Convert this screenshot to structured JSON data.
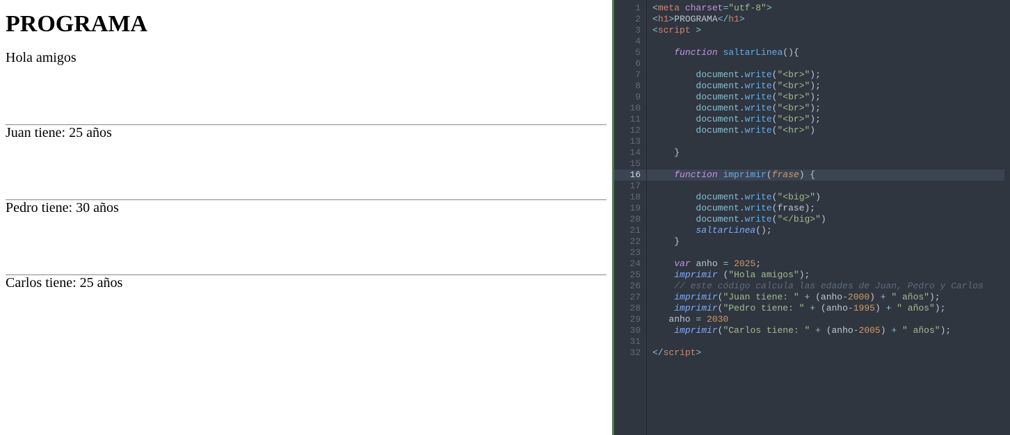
{
  "output": {
    "heading": "PROGRAMA",
    "lines": [
      "Hola amigos",
      "Juan tiene: 25 años",
      "Pedro tiene: 30 años",
      "Carlos tiene: 25 años"
    ]
  },
  "editor": {
    "highlighted_line": 16,
    "line_count": 32,
    "code_lines": {
      "l1": {
        "segments": [
          {
            "t": "<",
            "c": "pun"
          },
          {
            "t": "meta ",
            "c": "tag"
          },
          {
            "t": "charset",
            "c": "attr"
          },
          {
            "t": "=",
            "c": "pun"
          },
          {
            "t": "\"utf-8\"",
            "c": "str"
          },
          {
            "t": ">",
            "c": "pun"
          }
        ]
      },
      "l2": {
        "segments": [
          {
            "t": "<",
            "c": "pun"
          },
          {
            "t": "h1",
            "c": "tag"
          },
          {
            "t": ">",
            "c": "pun"
          },
          {
            "t": "PROGRAMA",
            "c": "plain"
          },
          {
            "t": "</",
            "c": "pun"
          },
          {
            "t": "h1",
            "c": "tag"
          },
          {
            "t": ">",
            "c": "pun"
          }
        ]
      },
      "l3": {
        "segments": [
          {
            "t": "<",
            "c": "pun"
          },
          {
            "t": "script ",
            "c": "tag"
          },
          {
            "t": ">",
            "c": "pun"
          }
        ]
      },
      "l4": {
        "segments": []
      },
      "l5": {
        "segments": [
          {
            "t": "    ",
            "c": "plain"
          },
          {
            "t": "function ",
            "c": "kw"
          },
          {
            "t": "saltarLinea",
            "c": "fn"
          },
          {
            "t": "(){",
            "c": "plain"
          }
        ]
      },
      "l6": {
        "segments": []
      },
      "l7": {
        "segments": [
          {
            "t": "        ",
            "c": "plain"
          },
          {
            "t": "document",
            "c": "obj"
          },
          {
            "t": ".",
            "c": "plain"
          },
          {
            "t": "write",
            "c": "prop"
          },
          {
            "t": "(",
            "c": "plain"
          },
          {
            "t": "\"<br>\"",
            "c": "str"
          },
          {
            "t": ");",
            "c": "plain"
          }
        ]
      },
      "l8": {
        "segments": [
          {
            "t": "        ",
            "c": "plain"
          },
          {
            "t": "document",
            "c": "obj"
          },
          {
            "t": ".",
            "c": "plain"
          },
          {
            "t": "write",
            "c": "prop"
          },
          {
            "t": "(",
            "c": "plain"
          },
          {
            "t": "\"<br>\"",
            "c": "str"
          },
          {
            "t": ");",
            "c": "plain"
          }
        ]
      },
      "l9": {
        "segments": [
          {
            "t": "        ",
            "c": "plain"
          },
          {
            "t": "document",
            "c": "obj"
          },
          {
            "t": ".",
            "c": "plain"
          },
          {
            "t": "write",
            "c": "prop"
          },
          {
            "t": "(",
            "c": "plain"
          },
          {
            "t": "\"<br>\"",
            "c": "str"
          },
          {
            "t": ");",
            "c": "plain"
          }
        ]
      },
      "l10": {
        "segments": [
          {
            "t": "        ",
            "c": "plain"
          },
          {
            "t": "document",
            "c": "obj"
          },
          {
            "t": ".",
            "c": "plain"
          },
          {
            "t": "write",
            "c": "prop"
          },
          {
            "t": "(",
            "c": "plain"
          },
          {
            "t": "\"<br>\"",
            "c": "str"
          },
          {
            "t": ");",
            "c": "plain"
          }
        ]
      },
      "l11": {
        "segments": [
          {
            "t": "        ",
            "c": "plain"
          },
          {
            "t": "document",
            "c": "obj"
          },
          {
            "t": ".",
            "c": "plain"
          },
          {
            "t": "write",
            "c": "prop"
          },
          {
            "t": "(",
            "c": "plain"
          },
          {
            "t": "\"<br>\"",
            "c": "str"
          },
          {
            "t": ");",
            "c": "plain"
          }
        ]
      },
      "l12": {
        "segments": [
          {
            "t": "        ",
            "c": "plain"
          },
          {
            "t": "document",
            "c": "obj"
          },
          {
            "t": ".",
            "c": "plain"
          },
          {
            "t": "write",
            "c": "prop"
          },
          {
            "t": "(",
            "c": "plain"
          },
          {
            "t": "\"<hr>\"",
            "c": "str"
          },
          {
            "t": ")",
            "c": "plain"
          }
        ]
      },
      "l13": {
        "segments": []
      },
      "l14": {
        "segments": [
          {
            "t": "    }",
            "c": "plain"
          }
        ]
      },
      "l15": {
        "segments": []
      },
      "l16": {
        "segments": [
          {
            "t": "    ",
            "c": "plain"
          },
          {
            "t": "function ",
            "c": "kw"
          },
          {
            "t": "imprimir",
            "c": "fn"
          },
          {
            "t": "(",
            "c": "plain"
          },
          {
            "t": "frase",
            "c": "param"
          },
          {
            "t": ") {",
            "c": "plain"
          }
        ]
      },
      "l17": {
        "segments": []
      },
      "l18": {
        "segments": [
          {
            "t": "        ",
            "c": "plain"
          },
          {
            "t": "document",
            "c": "obj"
          },
          {
            "t": ".",
            "c": "plain"
          },
          {
            "t": "write",
            "c": "prop"
          },
          {
            "t": "(",
            "c": "plain"
          },
          {
            "t": "\"<big>\"",
            "c": "str"
          },
          {
            "t": ")",
            "c": "plain"
          }
        ]
      },
      "l19": {
        "segments": [
          {
            "t": "        ",
            "c": "plain"
          },
          {
            "t": "document",
            "c": "obj"
          },
          {
            "t": ".",
            "c": "plain"
          },
          {
            "t": "write",
            "c": "prop"
          },
          {
            "t": "(",
            "c": "plain"
          },
          {
            "t": "frase",
            "c": "plain"
          },
          {
            "t": ");",
            "c": "plain"
          }
        ]
      },
      "l20": {
        "segments": [
          {
            "t": "        ",
            "c": "plain"
          },
          {
            "t": "document",
            "c": "obj"
          },
          {
            "t": ".",
            "c": "plain"
          },
          {
            "t": "write",
            "c": "prop"
          },
          {
            "t": "(",
            "c": "plain"
          },
          {
            "t": "\"</big>\"",
            "c": "str"
          },
          {
            "t": ")",
            "c": "plain"
          }
        ]
      },
      "l21": {
        "segments": [
          {
            "t": "        ",
            "c": "plain"
          },
          {
            "t": "saltarLinea",
            "c": "call"
          },
          {
            "t": "();",
            "c": "plain"
          }
        ]
      },
      "l22": {
        "segments": [
          {
            "t": "    }",
            "c": "plain"
          }
        ]
      },
      "l23": {
        "segments": []
      },
      "l24": {
        "segments": [
          {
            "t": "    ",
            "c": "plain"
          },
          {
            "t": "var ",
            "c": "kw"
          },
          {
            "t": "anho ",
            "c": "plain"
          },
          {
            "t": "= ",
            "c": "op"
          },
          {
            "t": "2025",
            "c": "num"
          },
          {
            "t": ";",
            "c": "plain"
          }
        ]
      },
      "l25": {
        "segments": [
          {
            "t": "    ",
            "c": "plain"
          },
          {
            "t": "imprimir ",
            "c": "call"
          },
          {
            "t": "(",
            "c": "plain"
          },
          {
            "t": "\"Hola amigos\"",
            "c": "str"
          },
          {
            "t": ");",
            "c": "plain"
          }
        ]
      },
      "l26": {
        "segments": [
          {
            "t": "    ",
            "c": "plain"
          },
          {
            "t": "// este código calcula las edades de Juan, Pedro y Carlos",
            "c": "cmt"
          }
        ]
      },
      "l27": {
        "segments": [
          {
            "t": "    ",
            "c": "plain"
          },
          {
            "t": "imprimir",
            "c": "call"
          },
          {
            "t": "(",
            "c": "plain"
          },
          {
            "t": "\"Juan tiene: \"",
            "c": "str"
          },
          {
            "t": " + ",
            "c": "op"
          },
          {
            "t": "(",
            "c": "plain"
          },
          {
            "t": "anho",
            "c": "plain"
          },
          {
            "t": "-",
            "c": "op"
          },
          {
            "t": "2000",
            "c": "num"
          },
          {
            "t": ") ",
            "c": "plain"
          },
          {
            "t": "+ ",
            "c": "op"
          },
          {
            "t": "\" años\"",
            "c": "str"
          },
          {
            "t": ");",
            "c": "plain"
          }
        ]
      },
      "l28": {
        "segments": [
          {
            "t": "    ",
            "c": "plain"
          },
          {
            "t": "imprimir",
            "c": "call"
          },
          {
            "t": "(",
            "c": "plain"
          },
          {
            "t": "\"Pedro tiene: \"",
            "c": "str"
          },
          {
            "t": " + ",
            "c": "op"
          },
          {
            "t": "(",
            "c": "plain"
          },
          {
            "t": "anho",
            "c": "plain"
          },
          {
            "t": "-",
            "c": "op"
          },
          {
            "t": "1995",
            "c": "num"
          },
          {
            "t": ") ",
            "c": "plain"
          },
          {
            "t": "+ ",
            "c": "op"
          },
          {
            "t": "\" años\"",
            "c": "str"
          },
          {
            "t": ");",
            "c": "plain"
          }
        ]
      },
      "l29": {
        "segments": [
          {
            "t": "   ",
            "c": "plain"
          },
          {
            "t": "anho ",
            "c": "plain"
          },
          {
            "t": "= ",
            "c": "op"
          },
          {
            "t": "2030",
            "c": "num"
          }
        ]
      },
      "l30": {
        "segments": [
          {
            "t": "    ",
            "c": "plain"
          },
          {
            "t": "imprimir",
            "c": "call"
          },
          {
            "t": "(",
            "c": "plain"
          },
          {
            "t": "\"Carlos tiene: \"",
            "c": "str"
          },
          {
            "t": " + ",
            "c": "op"
          },
          {
            "t": "(",
            "c": "plain"
          },
          {
            "t": "anho",
            "c": "plain"
          },
          {
            "t": "-",
            "c": "op"
          },
          {
            "t": "2005",
            "c": "num"
          },
          {
            "t": ") ",
            "c": "plain"
          },
          {
            "t": "+ ",
            "c": "op"
          },
          {
            "t": "\" años\"",
            "c": "str"
          },
          {
            "t": ");",
            "c": "plain"
          }
        ]
      },
      "l31": {
        "segments": []
      },
      "l32": {
        "segments": [
          {
            "t": "</",
            "c": "pun"
          },
          {
            "t": "script",
            "c": "tag"
          },
          {
            "t": ">",
            "c": "pun"
          }
        ]
      }
    }
  }
}
